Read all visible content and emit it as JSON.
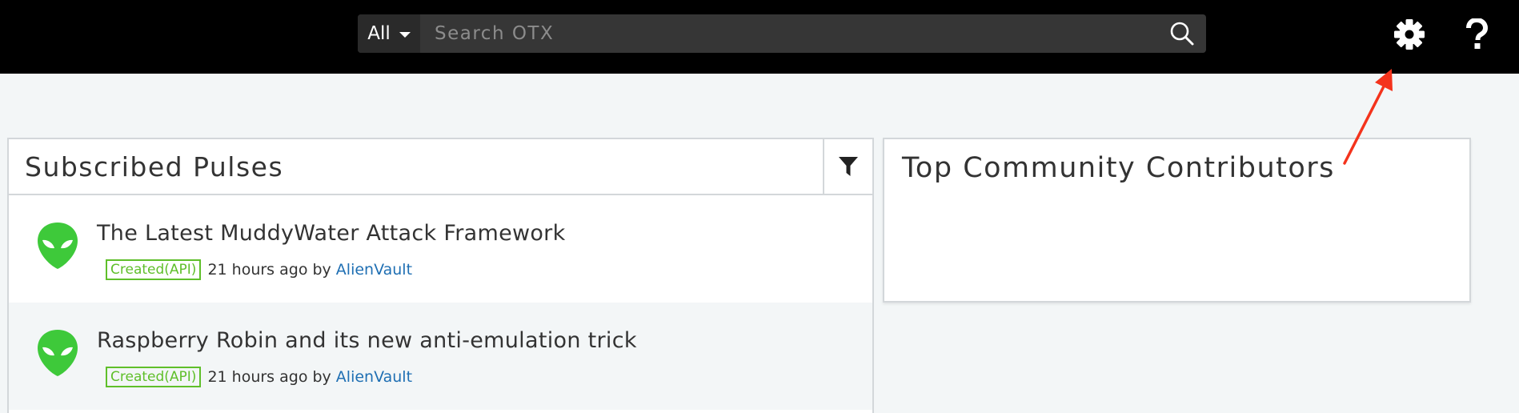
{
  "header": {
    "search_scope": "All",
    "search_placeholder": "Search OTX"
  },
  "pulses_panel": {
    "title": "Subscribed Pulses",
    "items": [
      {
        "title": "The Latest MuddyWater Attack Framework",
        "badge": "Created(API)",
        "time": "21 hours ago by",
        "author": "AlienVault"
      },
      {
        "title": "Raspberry Robin and its new anti-emulation trick",
        "badge": "Created(API)",
        "time": "21 hours ago by",
        "author": "AlienVault"
      }
    ]
  },
  "contributors_panel": {
    "title": "Top Community Contributors"
  },
  "colors": {
    "topbar": "#000000",
    "search_bg": "#363636",
    "alien_green": "#3ec93a",
    "badge_green": "#5fbf2a",
    "link_blue": "#1f6fb3",
    "annotation_red": "#f4331c"
  },
  "icons": [
    "search-icon",
    "gear-icon",
    "help-icon",
    "filter-icon",
    "alien-icon"
  ]
}
